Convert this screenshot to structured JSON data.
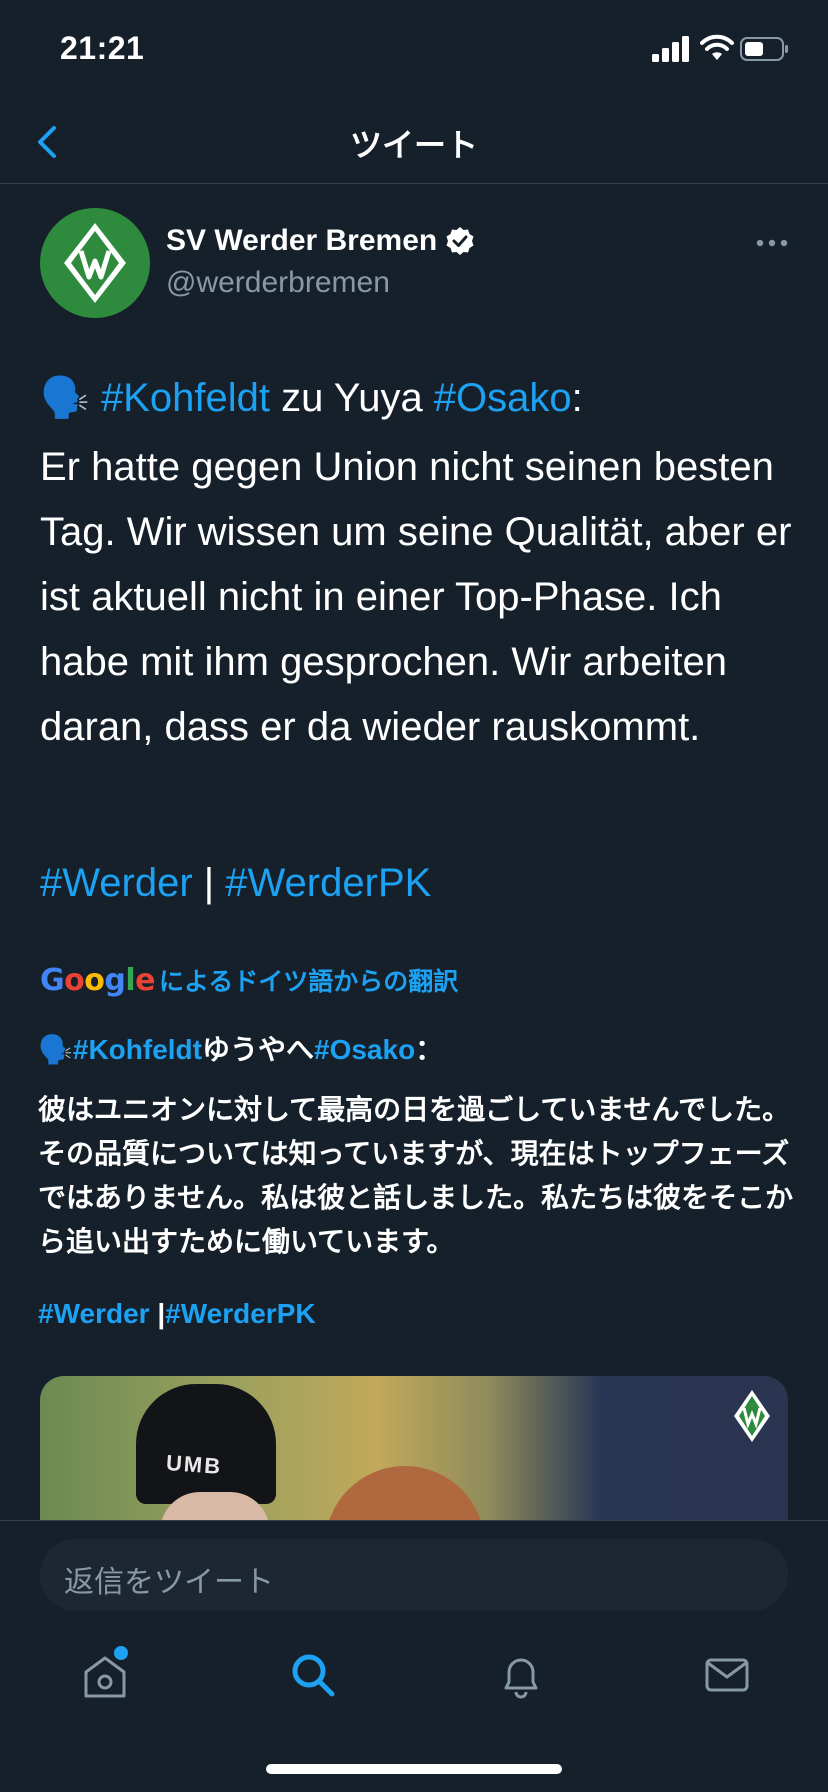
{
  "status": {
    "time": "21:21"
  },
  "nav": {
    "title": "ツイート"
  },
  "author": {
    "name": "SV Werder Bremen",
    "handle": "@werderbremen"
  },
  "tweet": {
    "emoji": "🗣️",
    "tag1": "#Kohfeldt",
    "mid": " zu Yuya ",
    "tag2": "#Osako",
    "colon": ":",
    "body": "Er hatte gegen Union nicht seinen besten Tag. Wir wissen um seine Qualität, aber er ist aktuell nicht in einer Top-Phase. Ich habe mit ihm gesprochen. Wir arbeiten daran, dass er da wieder rauskommt.",
    "hashtag1": "#Werder",
    "separator": " | ",
    "hashtag2": "#WerderPK"
  },
  "translation": {
    "google": "Google",
    "label": "によるドイツ語からの翻訳",
    "tag1": "#Kohfeldt",
    "mid": "ゆうやへ",
    "tag2": "#Osako",
    "colon": "：",
    "body": "彼はユニオンに対して最高の日を過ごしていませんでした。その品質については知っていますが、現在はトップフェーズではありません。私は彼と話しました。私たちは彼をそこから追い出すために働いています。",
    "hashtag1": "#Werder",
    "separator": " |",
    "hashtag2": "#WerderPK"
  },
  "media": {
    "beanie_text": "UMB"
  },
  "reply": {
    "placeholder": "返信をツイート"
  },
  "colors": {
    "background": "#15202b",
    "accent": "#1da1f2",
    "secondary_text": "#8899a6",
    "club_green": "#2e8b3e"
  },
  "icons": [
    "back-chevron-icon",
    "verified-badge-icon",
    "more-dots-icon",
    "home-icon",
    "search-icon",
    "bell-icon",
    "mail-icon"
  ]
}
